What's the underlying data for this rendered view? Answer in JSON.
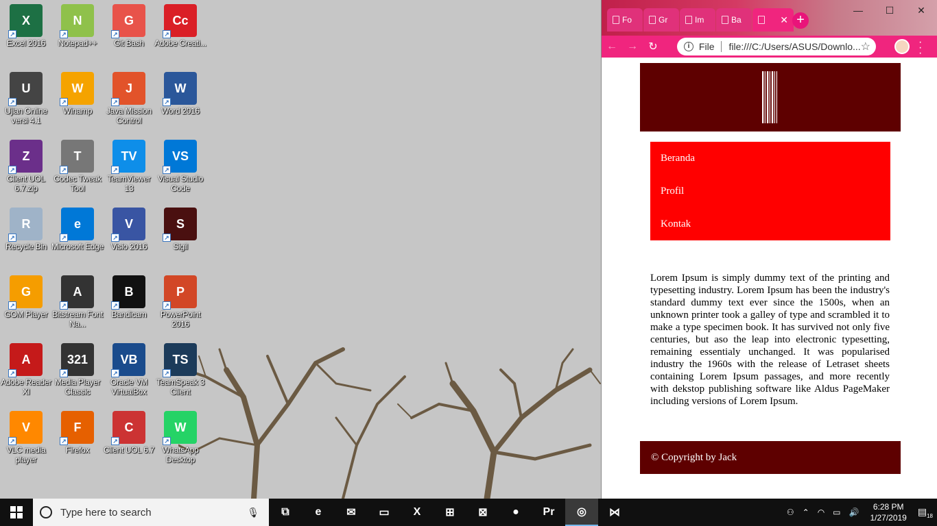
{
  "desktop": {
    "icons": [
      {
        "label": "Excel 2016",
        "color": "#1d7044",
        "glyph": "X"
      },
      {
        "label": "Notepad++",
        "color": "#8fc14b",
        "glyph": "N"
      },
      {
        "label": "Git Bash",
        "color": "#e8534a",
        "glyph": "G"
      },
      {
        "label": "Adobe Creati...",
        "color": "#da1f26",
        "glyph": "Cc"
      },
      {
        "label": "Ujian Online versi 4.1",
        "color": "#444444",
        "glyph": "U"
      },
      {
        "label": "Winamp",
        "color": "#f5a300",
        "glyph": "W"
      },
      {
        "label": "Java Mission Control",
        "color": "#e2532a",
        "glyph": "J"
      },
      {
        "label": "Word 2016",
        "color": "#2b579a",
        "glyph": "W"
      },
      {
        "label": "Client UOL 6.7.zip",
        "color": "#6b2f8a",
        "glyph": "Z"
      },
      {
        "label": "Codec Tweak Tool",
        "color": "#777777",
        "glyph": "T"
      },
      {
        "label": "TeamViewer 13",
        "color": "#0e8ee9",
        "glyph": "TV"
      },
      {
        "label": "Visual Studio Code",
        "color": "#0078d7",
        "glyph": "VS"
      },
      {
        "label": "Recycle Bin",
        "color": "#9fb3c8",
        "glyph": "R"
      },
      {
        "label": "Microsoft Edge",
        "color": "#0078d7",
        "glyph": "e"
      },
      {
        "label": "Visio 2016",
        "color": "#3955a3",
        "glyph": "V"
      },
      {
        "label": "Sigil",
        "color": "#4a1010",
        "glyph": "S"
      },
      {
        "label": "GOM Player",
        "color": "#f59d00",
        "glyph": "G"
      },
      {
        "label": "Bitstream Font Na...",
        "color": "#333333",
        "glyph": "A"
      },
      {
        "label": "Bandicam",
        "color": "#111111",
        "glyph": "B"
      },
      {
        "label": "PowerPoint 2016",
        "color": "#d24726",
        "glyph": "P"
      },
      {
        "label": "Adobe Reader XI",
        "color": "#c51a1a",
        "glyph": "A"
      },
      {
        "label": "Media Player Classic",
        "color": "#333333",
        "glyph": "321"
      },
      {
        "label": "Oracle VM VirtualBox",
        "color": "#1a4b8c",
        "glyph": "VB"
      },
      {
        "label": "TeamSpeak 3 Client",
        "color": "#1c3b5a",
        "glyph": "TS"
      },
      {
        "label": "VLC media player",
        "color": "#ff8800",
        "glyph": "V"
      },
      {
        "label": "Firefox",
        "color": "#e66000",
        "glyph": "F"
      },
      {
        "label": "Client UOL 6.7",
        "color": "#cc3333",
        "glyph": "C"
      },
      {
        "label": "WhatsApp Desktop",
        "color": "#25d366",
        "glyph": "W"
      }
    ]
  },
  "browser": {
    "tabs": [
      {
        "label": "Fo"
      },
      {
        "label": "Gr"
      },
      {
        "label": "Im"
      },
      {
        "label": "Ba"
      },
      {
        "label": "",
        "active": true
      }
    ],
    "address": {
      "scheme": "File",
      "url": "file:///C:/Users/ASUS/Downlo..."
    },
    "page": {
      "nav": [
        "Beranda",
        "Profil",
        "Kontak"
      ],
      "content": "Lorem Ipsum is simply dummy text of the printing and typesetting industry. Lorem Ipsum has been the industry's standard dummy text ever since the 1500s, when an unknown printer took a galley of type and scrambled it to make a type specimen book. It has survived not only five centuries, but aso the leap into electronic typesetting, remaining essentialy unchanged. It was popularised industry the 1960s with the release of Letraset sheets containing Lorem Ipsum passages, and more recently with dekstop publishing software like Aldus PageMaker including versions of Lorem Ipsum.",
      "footer": "© Copyright by Jack"
    }
  },
  "taskbar": {
    "search_placeholder": "Type here to search",
    "apps": [
      {
        "name": "task-view",
        "glyph": "⧉"
      },
      {
        "name": "edge",
        "glyph": "e"
      },
      {
        "name": "mail",
        "glyph": "✉"
      },
      {
        "name": "file-explorer",
        "glyph": "▭"
      },
      {
        "name": "excel",
        "glyph": "X"
      },
      {
        "name": "store",
        "glyph": "⊞"
      },
      {
        "name": "xampp",
        "glyph": "⊠"
      },
      {
        "name": "bandicam",
        "glyph": "●"
      },
      {
        "name": "premiere",
        "glyph": "Pr"
      },
      {
        "name": "chrome",
        "glyph": "◎",
        "active": true
      },
      {
        "name": "vscode",
        "glyph": "⋈"
      }
    ],
    "time": "6:28 PM",
    "date": "1/27/2019",
    "notifications": "18"
  }
}
